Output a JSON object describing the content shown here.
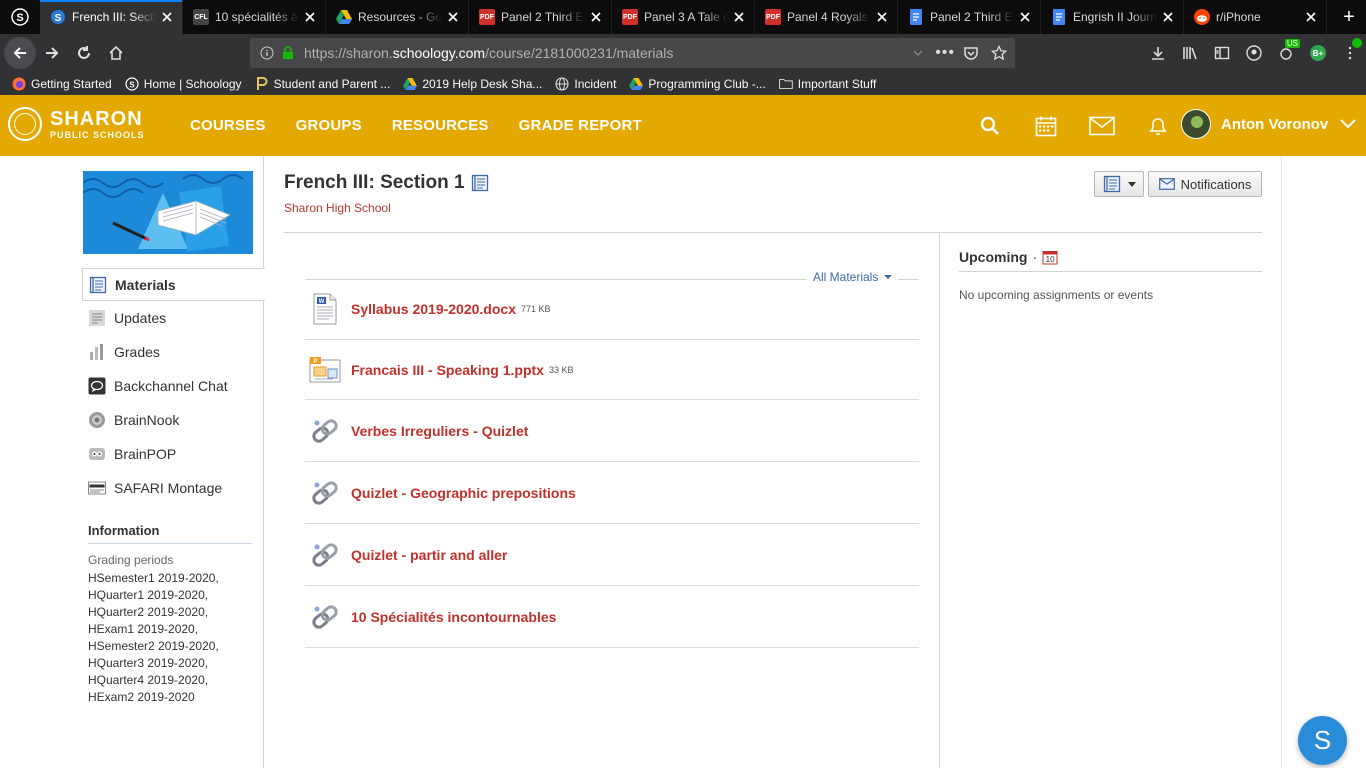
{
  "browser": {
    "tabs": [
      {
        "title": "French III: Secti",
        "favicon": "S",
        "favicon_color": "#2a7bd8",
        "active": true
      },
      {
        "title": "10 spécialités à",
        "favicon": "CFL",
        "favicon_color": "#444444",
        "active": false
      },
      {
        "title": "Resources - Go",
        "favicon": "drive",
        "favicon_color": "#1fa463",
        "active": false
      },
      {
        "title": "Panel 2 Third Es",
        "favicon": "PDF",
        "favicon_color": "#d0302b",
        "active": false
      },
      {
        "title": "Panel 3 A Tale o",
        "favicon": "PDF",
        "favicon_color": "#d0302b",
        "active": false
      },
      {
        "title": "Panel 4 Royals I",
        "favicon": "PDF",
        "favicon_color": "#d0302b",
        "active": false
      },
      {
        "title": "Panel 2 Third Es",
        "favicon": "doc",
        "favicon_color": "#4285f4",
        "active": false
      },
      {
        "title": "Engrish II Journ",
        "favicon": "doc",
        "favicon_color": "#4285f4",
        "active": false
      },
      {
        "title": "r/iPhone",
        "favicon": "reddit",
        "favicon_color": "#ff4500",
        "active": false
      }
    ],
    "url_prefix": "https://sharon.",
    "url_domain": "schoology.com",
    "url_path": "/course/2181000231/materials",
    "bookmarks": [
      {
        "label": "Getting Started",
        "icon": "firefox-icon"
      },
      {
        "label": "Home | Schoology",
        "icon": "schoology-icon"
      },
      {
        "label": "Student and Parent ...",
        "icon": "p-icon"
      },
      {
        "label": "2019 Help Desk Sha...",
        "icon": "drive-icon"
      },
      {
        "label": "Incident",
        "icon": "globe-icon"
      },
      {
        "label": "Programming Club -...",
        "icon": "drive-icon"
      },
      {
        "label": "Important Stuff",
        "icon": "folder-icon"
      }
    ],
    "ext_badge": "US",
    "ext_b_label": "B+"
  },
  "header": {
    "logo_line1": "SHARON",
    "logo_line2": "PUBLIC SCHOOLS",
    "nav": [
      "COURSES",
      "GROUPS",
      "RESOURCES",
      "GRADE REPORT"
    ],
    "user_name": "Anton Voronov",
    "brand_color": "#e3a900"
  },
  "course": {
    "title": "French III: Section 1",
    "school": "Sharon High School",
    "notifications_label": "Notifications"
  },
  "sidebar": {
    "items": [
      {
        "label": "Materials",
        "icon": "materials-icon",
        "active": true
      },
      {
        "label": "Updates",
        "icon": "updates-icon",
        "active": false
      },
      {
        "label": "Grades",
        "icon": "grades-icon",
        "active": false
      },
      {
        "label": "Backchannel Chat",
        "icon": "chat-icon",
        "active": false
      },
      {
        "label": "BrainNook",
        "icon": "brainnook-icon",
        "active": false
      },
      {
        "label": "BrainPOP",
        "icon": "brainpop-icon",
        "active": false
      },
      {
        "label": "SAFARI Montage",
        "icon": "safari-icon",
        "active": false
      }
    ],
    "info_title": "Information",
    "grading_label": "Grading periods",
    "grading_periods": [
      "HSemester1 2019-2020,",
      "HQuarter1 2019-2020,",
      "HQuarter2 2019-2020,",
      "HExam1 2019-2020,",
      "HSemester2 2019-2020,",
      "HQuarter3 2019-2020,",
      "HQuarter4 2019-2020,",
      "HExam2 2019-2020"
    ]
  },
  "materials": {
    "filter_label": "All Materials",
    "items": [
      {
        "title": "Syllabus 2019-2020.docx",
        "size": "771 KB",
        "icon": "docx-icon"
      },
      {
        "title": "Francais III - Speaking 1.pptx",
        "size": "33 KB",
        "icon": "pptx-icon"
      },
      {
        "title": "Verbes Irreguliers - Quizlet",
        "size": "",
        "icon": "link-icon"
      },
      {
        "title": "Quizlet - Geographic prepositions",
        "size": "",
        "icon": "link-icon"
      },
      {
        "title": "Quizlet - partir and aller",
        "size": "",
        "icon": "link-icon"
      },
      {
        "title": "10 Spécialités incontournables",
        "size": "",
        "icon": "link-icon"
      }
    ]
  },
  "upcoming": {
    "title": "Upcoming",
    "calendar_day": "10",
    "empty_text": "No upcoming assignments or events"
  },
  "fab_label": "S"
}
